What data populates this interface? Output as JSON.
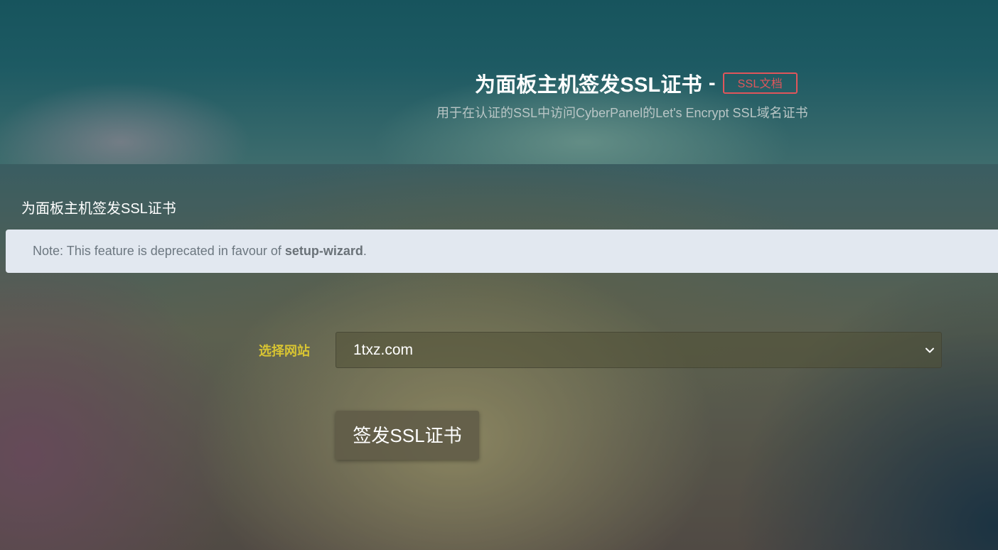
{
  "hero": {
    "title": "为面板主机签发SSL证书",
    "separator": "-",
    "doc_badge": "SSL文档",
    "subtitle": "用于在认证的SSL中访问CyberPanel的Let's Encrypt SSL域名证书"
  },
  "panel": {
    "title": "为面板主机签发SSL证书",
    "note_prefix": "Note: This feature is deprecated in favour of ",
    "note_link": "setup-wizard",
    "note_suffix": "."
  },
  "form": {
    "website_label": "选择网站",
    "website_selected": "1txz.com",
    "issue_button": "签发SSL证书"
  },
  "colors": {
    "badge": "#e0565b",
    "label": "#d8c432",
    "note_bg": "#e2e8f0"
  },
  "icons": {
    "select_chevron": "chevron-down-icon"
  }
}
